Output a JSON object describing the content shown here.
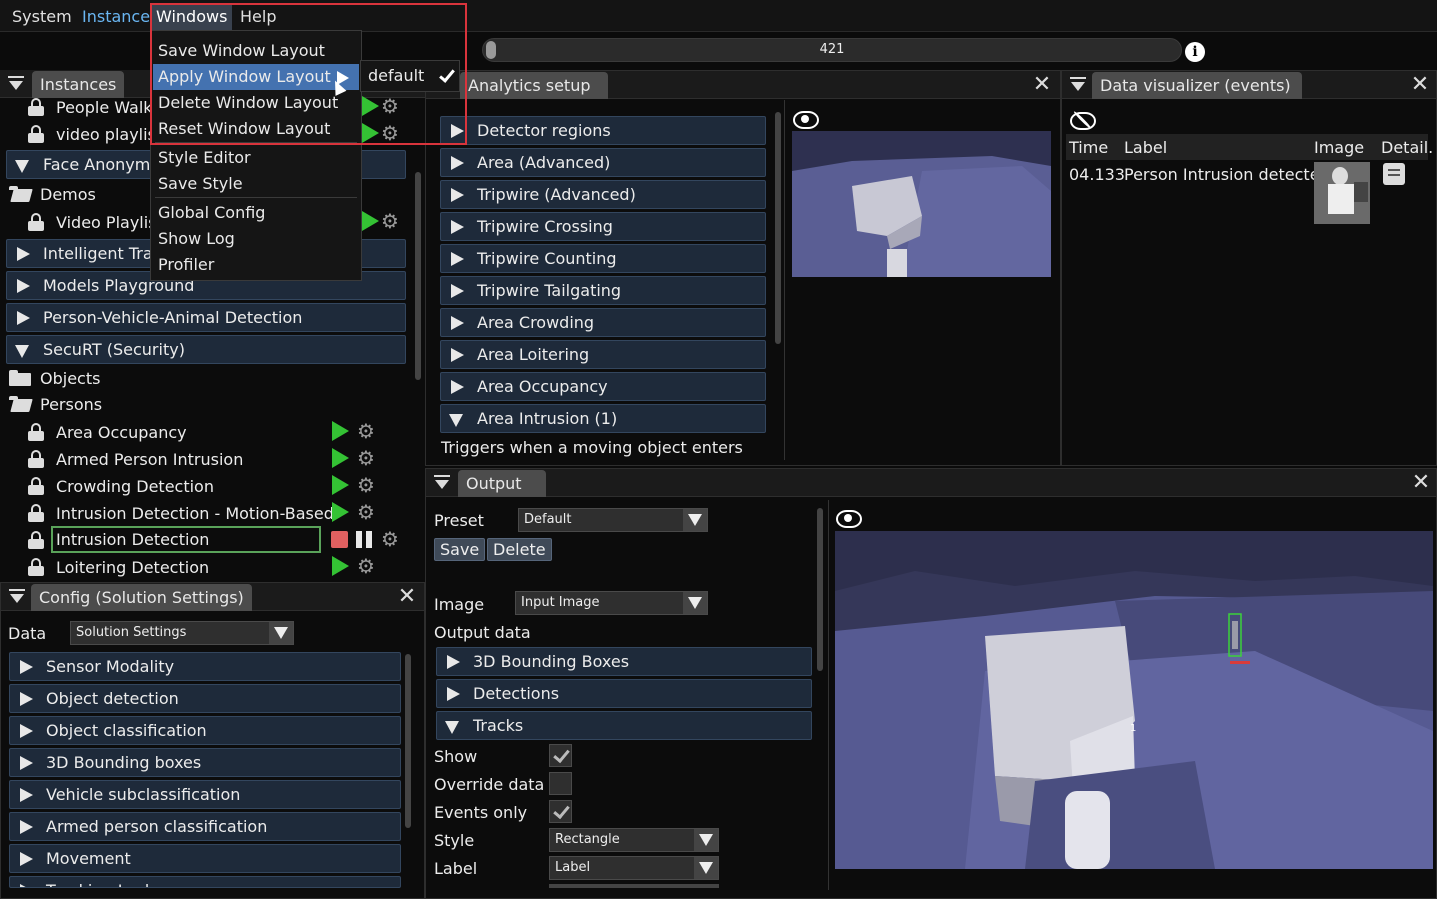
{
  "menubar": {
    "system": "System",
    "instance": "Instance",
    "windows": "Windows",
    "help": "Help"
  },
  "timeline": {
    "value": "421"
  },
  "windows_menu": {
    "items": [
      "Save Window Layout",
      "Apply Window Layout",
      "Delete Window Layout",
      "Reset Window Layout",
      "Style Editor",
      "Save Style",
      "Global Config",
      "Show Log",
      "Profiler"
    ],
    "submenu_item": "default"
  },
  "instances_panel": {
    "title": "Instances",
    "rows": {
      "people_walking": "People Walki",
      "video_playlist": "video playlist",
      "face_anonym": "Face Anonymi",
      "demos": "Demos",
      "video_playlist2": "Video Playlist",
      "intelligent": "Intelligent Traf",
      "models": "Models Playground",
      "pva": "Person-Vehicle-Animal Detection",
      "securt": "SecuRT (Security)",
      "objects": "Objects",
      "persons": "Persons",
      "area_occ": "Area Occupancy",
      "armed": "Armed Person Intrusion",
      "crowding": "Crowding Detection",
      "intrusion_motion": "Intrusion Detection - Motion-Based",
      "intrusion": "Intrusion Detection",
      "loitering": "Loitering Detection"
    }
  },
  "config_panel": {
    "title": "Config (Solution Settings)",
    "data_label": "Data",
    "data_select": "Solution Settings",
    "sections": [
      "Sensor Modality",
      "Object detection",
      "Object classification",
      "3D Bounding boxes",
      "Vehicle subclassification",
      "Armed person classification",
      "Movement",
      "Tracking Lock"
    ]
  },
  "analytics_panel": {
    "title": "Analytics setup",
    "sections": [
      "Detector regions",
      "Area (Advanced)",
      "Tripwire (Advanced)",
      "Tripwire Crossing",
      "Tripwire Counting",
      "Tripwire Tailgating",
      "Area Crowding",
      "Area Loitering",
      "Area Occupancy",
      "Area Intrusion (1)"
    ],
    "description": "Triggers when a moving object enters"
  },
  "visualizer_panel": {
    "title": "Data visualizer (events)",
    "columns": [
      "Time",
      "Label",
      "Image",
      "Detail."
    ],
    "rows": [
      {
        "time": "04.133",
        "label": "Person Intrusion detected"
      }
    ]
  },
  "output_panel": {
    "title": "Output",
    "preset_label": "Preset",
    "preset_value": "Default",
    "save": "Save",
    "delete": "Delete",
    "image_label": "Image",
    "image_value": "Input Image",
    "output_data": "Output data",
    "sections": [
      "3D Bounding Boxes",
      "Detections",
      "Tracks"
    ],
    "show": "Show",
    "override": "Override data",
    "events_only": "Events only",
    "style_label": "Style",
    "style_value": "Rectangle",
    "label_label": "Label",
    "label_value": "Label",
    "track_id": "1"
  },
  "colors": {
    "accent": "#4472b0",
    "instance_menu": "#6ab6f2",
    "highlight_box": "#d9343c",
    "play": "#34c234",
    "header_bg": "#1e2a3a"
  }
}
